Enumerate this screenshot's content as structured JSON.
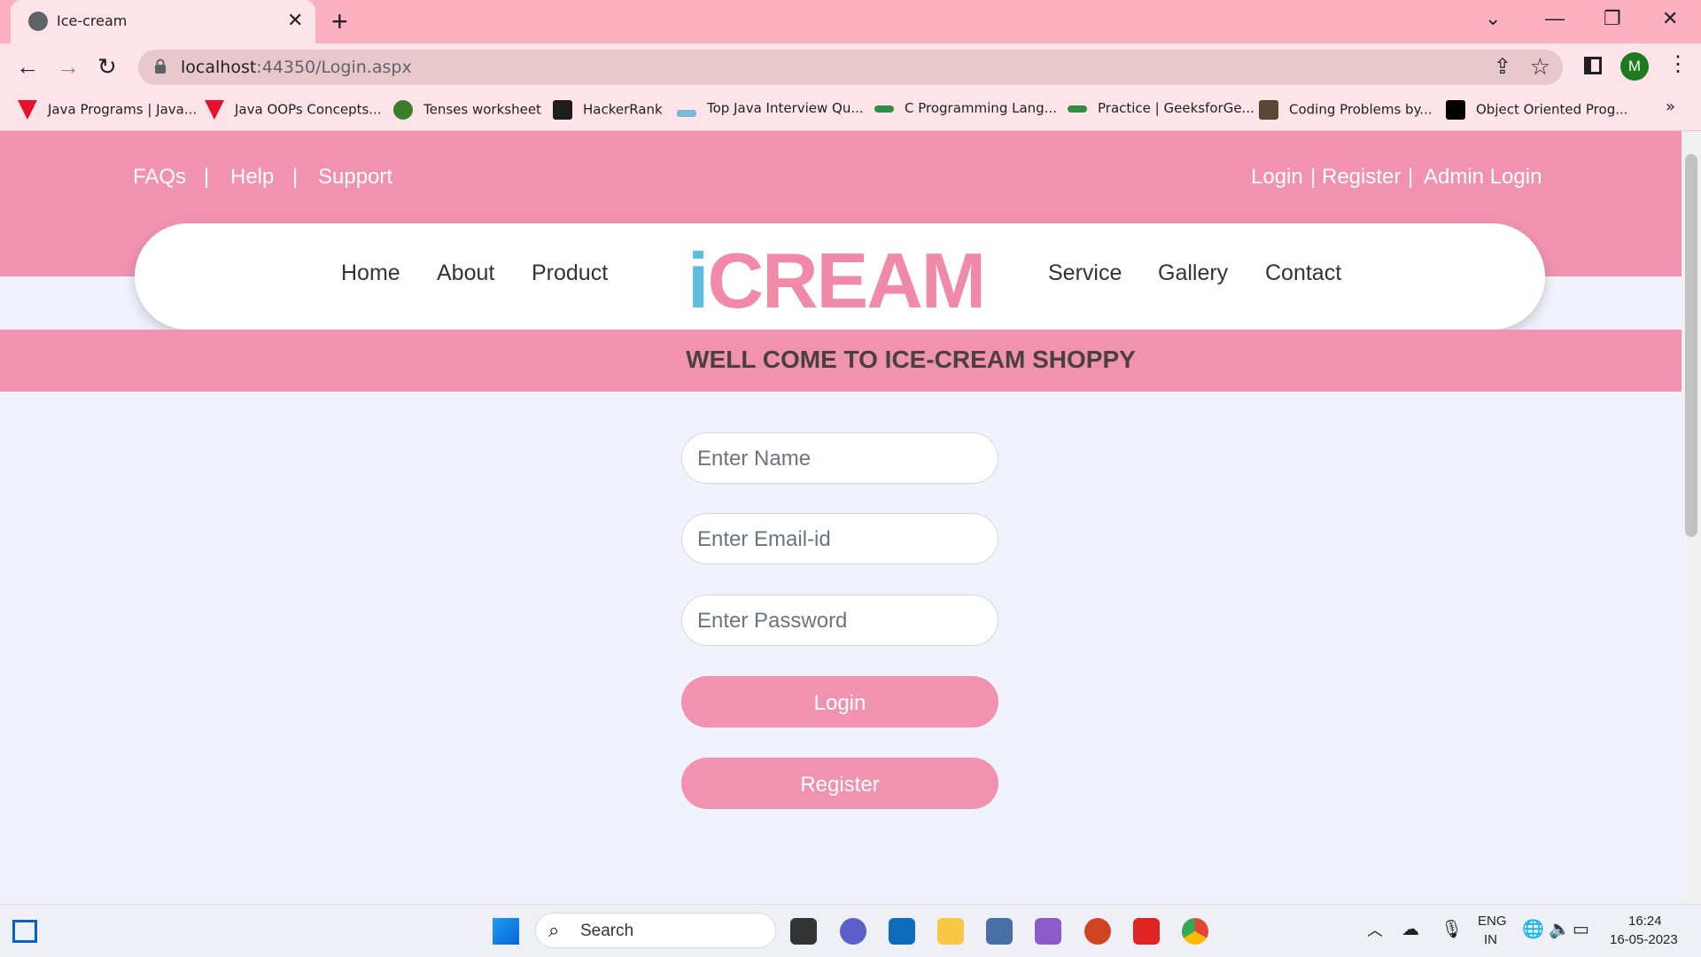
{
  "browser": {
    "tab_title": "Ice-cream",
    "new_tab": "+",
    "url_host": "localhost",
    "url_rest": ":44350/Login.aspx",
    "avatar_letter": "M",
    "bookmarks": [
      {
        "label": "Java Programs | Java...",
        "icon": "tpoint-icon",
        "color": "#e8112d"
      },
      {
        "label": "Java OOPs Concepts...",
        "icon": "tpoint-icon",
        "color": "#e8112d"
      },
      {
        "label": "Tenses worksheet",
        "icon": "leaf-icon",
        "color": "#3a7d2c"
      },
      {
        "label": "HackerRank",
        "icon": "hackerrank-icon",
        "color": "#1d1d1d"
      },
      {
        "label": "Top Java Interview Qu...",
        "icon": "chart-icon",
        "color": "#7ab7d8"
      },
      {
        "label": "C Programming Lang...",
        "icon": "gfg-icon",
        "color": "#2f8d46"
      },
      {
        "label": "Practice | GeeksforGe...",
        "icon": "gfg-icon",
        "color": "#2f8d46"
      },
      {
        "label": "Coding Problems by...",
        "icon": "codechef-icon",
        "color": "#5b4638"
      },
      {
        "label": "Object Oriented Prog...",
        "icon": "medium-icon",
        "color": "#000000"
      }
    ],
    "more_bookmarks": "»"
  },
  "site": {
    "top_left_links": [
      "FAQs",
      "|",
      "Help",
      "|",
      "Support"
    ],
    "top_right_links": [
      "Login",
      "|",
      "Register",
      "|",
      "Admin Login"
    ],
    "nav_left": [
      "Home",
      "About",
      "Product"
    ],
    "nav_right": [
      "Service",
      "Gallery",
      "Contact"
    ],
    "logo_i": "i",
    "logo_rest": "CREAM",
    "welcome": "WELL COME TO ICE-CREAM SHOPPY"
  },
  "form": {
    "name_placeholder": "Enter Name",
    "email_placeholder": "Enter Email-id",
    "password_placeholder": "Enter Password",
    "login_label": "Login",
    "register_label": "Register"
  },
  "taskbar": {
    "search_label": "Search",
    "lang_top": "ENG",
    "lang_bottom": "IN",
    "time": "16:24",
    "date": "16-05-2023"
  },
  "colors": {
    "pink": "#f193b0",
    "logo_blue": "#5bbde0",
    "logo_pink": "#f18aa8"
  }
}
